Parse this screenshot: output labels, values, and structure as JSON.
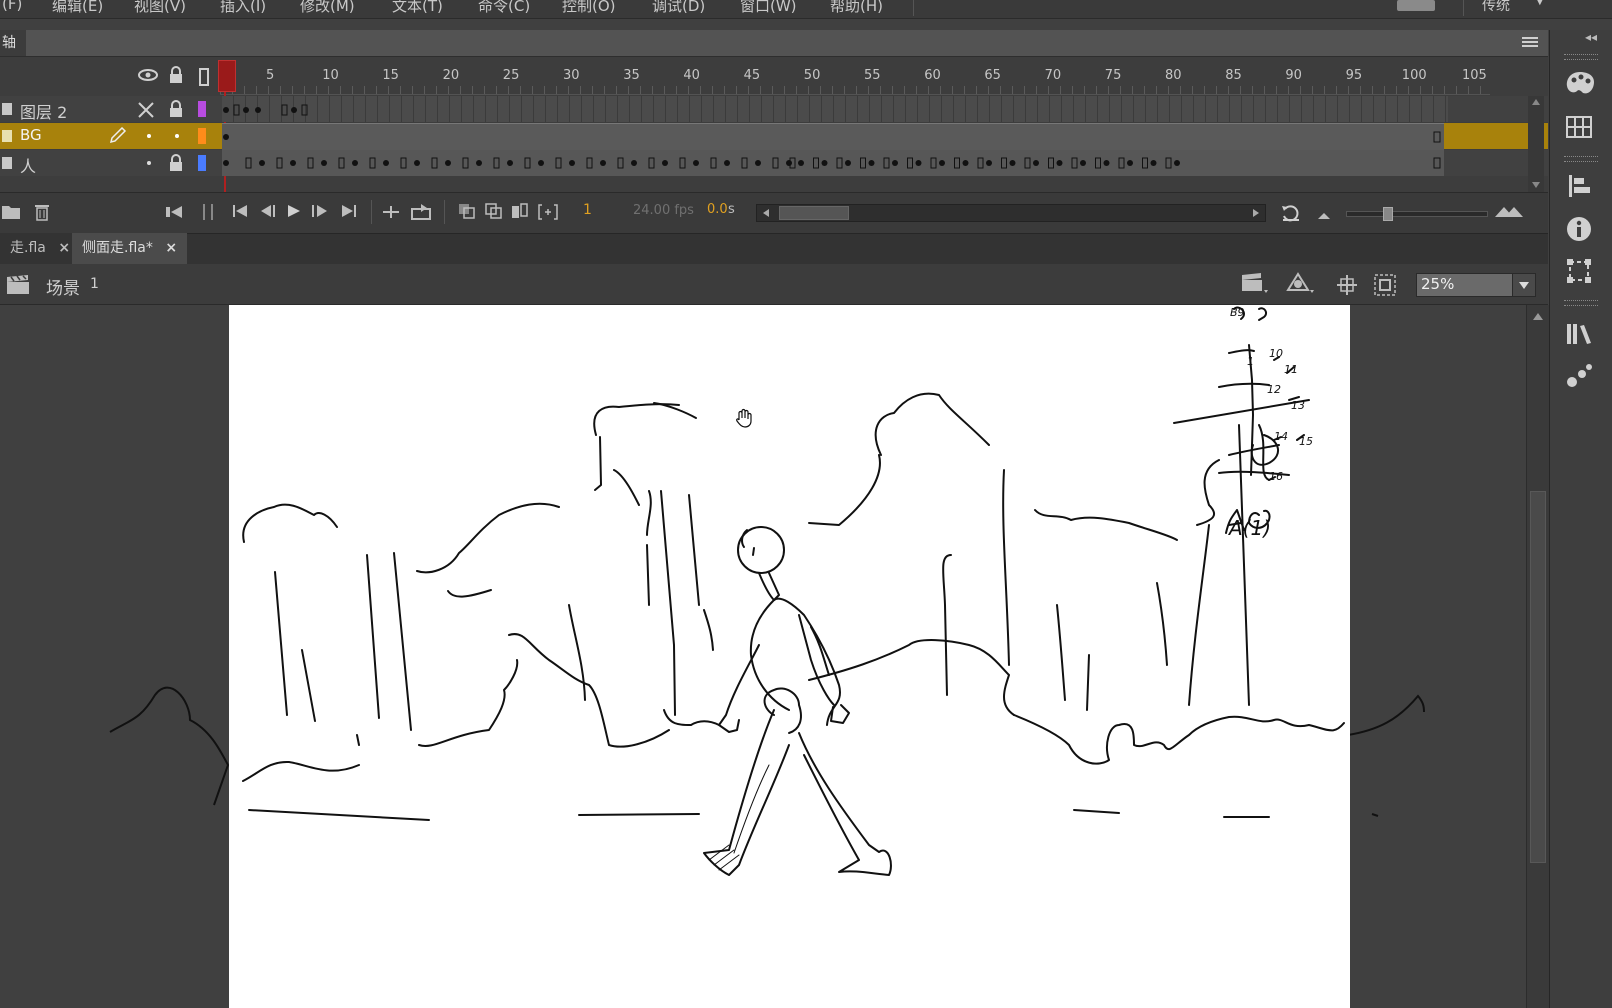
{
  "menu": {
    "items": [
      "(F)",
      "编辑(E)",
      "视图(V)",
      "插入(I)",
      "修改(M)",
      "文本(T)",
      "命令(C)",
      "控制(O)",
      "调试(D)",
      "窗口(W)",
      "帮助(H)"
    ],
    "workspace": "传统"
  },
  "timeline": {
    "tab_label": "轴",
    "ruler": [
      "1",
      "5",
      "10",
      "15",
      "20",
      "25",
      "30",
      "35",
      "40",
      "45",
      "50",
      "55",
      "60",
      "65",
      "70",
      "75",
      "80",
      "85",
      "90",
      "95",
      "100",
      "105"
    ],
    "layers": [
      {
        "name": "图层 2",
        "color": "#b84ce0",
        "selected": false
      },
      {
        "name": "BG",
        "color": "#ff8c1a",
        "selected": true
      },
      {
        "name": "人",
        "color": "#4a7cff",
        "selected": false
      }
    ],
    "current_frame": "1",
    "fps": "24.00 fps",
    "time": "0.0",
    "time_unit": "s"
  },
  "doc_tabs": [
    {
      "label": "走.fla",
      "active": false
    },
    {
      "label": "侧面走.fla*",
      "active": true
    }
  ],
  "scene": {
    "label": "场景",
    "number": "1",
    "zoom": "25%"
  },
  "stage": {
    "background": "#ffffff",
    "notes": [
      "B9",
      "1",
      "10",
      "11",
      "12",
      "13",
      "14",
      "15",
      "16",
      "A(1)"
    ]
  },
  "icons": {
    "eye": "eye-icon",
    "lock": "lock-icon",
    "outline": "outline-icon",
    "x": "hide-x-icon",
    "pencil": "pencil-icon",
    "new_folder": "new-folder-icon",
    "trash": "trash-icon"
  }
}
